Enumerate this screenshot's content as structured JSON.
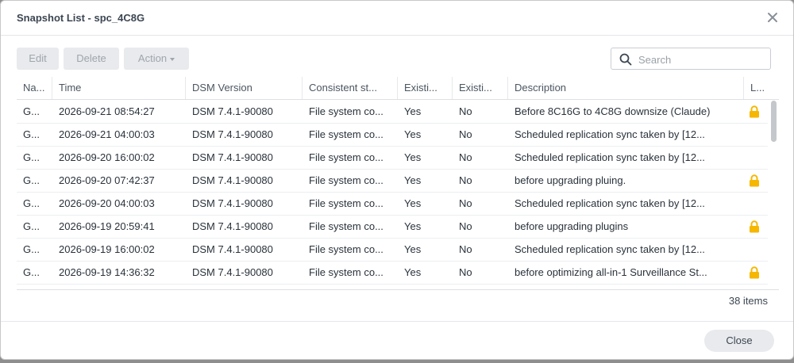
{
  "window": {
    "title": "Snapshot List - spc_4C8G"
  },
  "toolbar": {
    "edit_label": "Edit",
    "delete_label": "Delete",
    "action_label": "Action",
    "search_placeholder": "Search"
  },
  "table": {
    "columns": [
      "Na...",
      "Time",
      "DSM Version",
      "Consistent st...",
      "Existi...",
      "Existi...",
      "Description",
      "L..."
    ],
    "rows": [
      {
        "name": "G...",
        "time": "2026-09-21 08:54:27",
        "dsm": "DSM 7.4.1-90080",
        "consistent": "File system co...",
        "existing1": "Yes",
        "existing2": "No",
        "description": "Before 8C16G to 4C8G downsize (Claude)",
        "locked": true
      },
      {
        "name": "G...",
        "time": "2026-09-21 04:00:03",
        "dsm": "DSM 7.4.1-90080",
        "consistent": "File system co...",
        "existing1": "Yes",
        "existing2": "No",
        "description": "Scheduled replication sync taken by [12...",
        "locked": false
      },
      {
        "name": "G...",
        "time": "2026-09-20 16:00:02",
        "dsm": "DSM 7.4.1-90080",
        "consistent": "File system co...",
        "existing1": "Yes",
        "existing2": "No",
        "description": "Scheduled replication sync taken by [12...",
        "locked": false
      },
      {
        "name": "G...",
        "time": "2026-09-20 07:42:37",
        "dsm": "DSM 7.4.1-90080",
        "consistent": "File system co...",
        "existing1": "Yes",
        "existing2": "No",
        "description": "before upgrading pluing.",
        "locked": true
      },
      {
        "name": "G...",
        "time": "2026-09-20 04:00:03",
        "dsm": "DSM 7.4.1-90080",
        "consistent": "File system co...",
        "existing1": "Yes",
        "existing2": "No",
        "description": "Scheduled replication sync taken by [12...",
        "locked": false
      },
      {
        "name": "G...",
        "time": "2026-09-19 20:59:41",
        "dsm": "DSM 7.4.1-90080",
        "consistent": "File system co...",
        "existing1": "Yes",
        "existing2": "No",
        "description": "before upgrading plugins",
        "locked": true
      },
      {
        "name": "G...",
        "time": "2026-09-19 16:00:02",
        "dsm": "DSM 7.4.1-90080",
        "consistent": "File system co...",
        "existing1": "Yes",
        "existing2": "No",
        "description": "Scheduled replication sync taken by [12...",
        "locked": false
      },
      {
        "name": "G...",
        "time": "2026-09-19 14:36:32",
        "dsm": "DSM 7.4.1-90080",
        "consistent": "File system co...",
        "existing1": "Yes",
        "existing2": "No",
        "description": "before optimizing all-in-1 Surveillance St...",
        "locked": true
      }
    ],
    "items_count": "38 items"
  },
  "footer": {
    "close_label": "Close"
  },
  "colors": {
    "lock": "#f5b700",
    "button_bg": "#e8eaed",
    "disabled_text": "#a0a6ad"
  },
  "icons": {
    "close": "close-icon",
    "search": "search-icon",
    "lock": "lock-icon",
    "caret": "caret-down-icon"
  }
}
